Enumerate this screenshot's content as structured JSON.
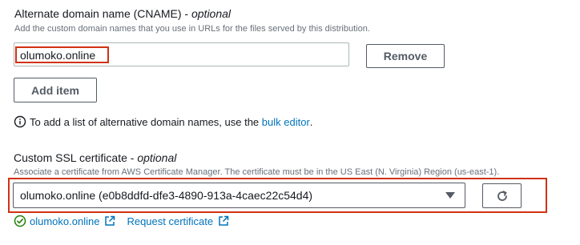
{
  "cname": {
    "title": "Alternate domain name (CNAME)",
    "title_optional": "optional",
    "description": "Add the custom domain names that you use in URLs for the files served by this distribution.",
    "items": [
      {
        "value": "olumoko.online"
      }
    ],
    "remove_label": "Remove",
    "add_item_label": "Add item",
    "info_text": "To add a list of alternative domain names, use the",
    "info_link": "bulk editor",
    "info_suffix": "."
  },
  "ssl": {
    "title": "Custom SSL certificate",
    "title_optional": "optional",
    "description": "Associate a certificate from AWS Certificate Manager. The certificate must be in the US East (N. Virginia) Region (us-east-1).",
    "selected": "olumoko.online (e0b8ddfd-dfe3-4890-913a-4caec22c54d4)",
    "cert_link": "olumoko.online",
    "request_link": "Request certificate"
  },
  "colors": {
    "highlight": "#d13212",
    "link": "#0073bb",
    "success": "#1d8102"
  },
  "icons": [
    "info-icon",
    "caret-down-icon",
    "refresh-icon",
    "success-check-icon",
    "external-link-icon"
  ]
}
